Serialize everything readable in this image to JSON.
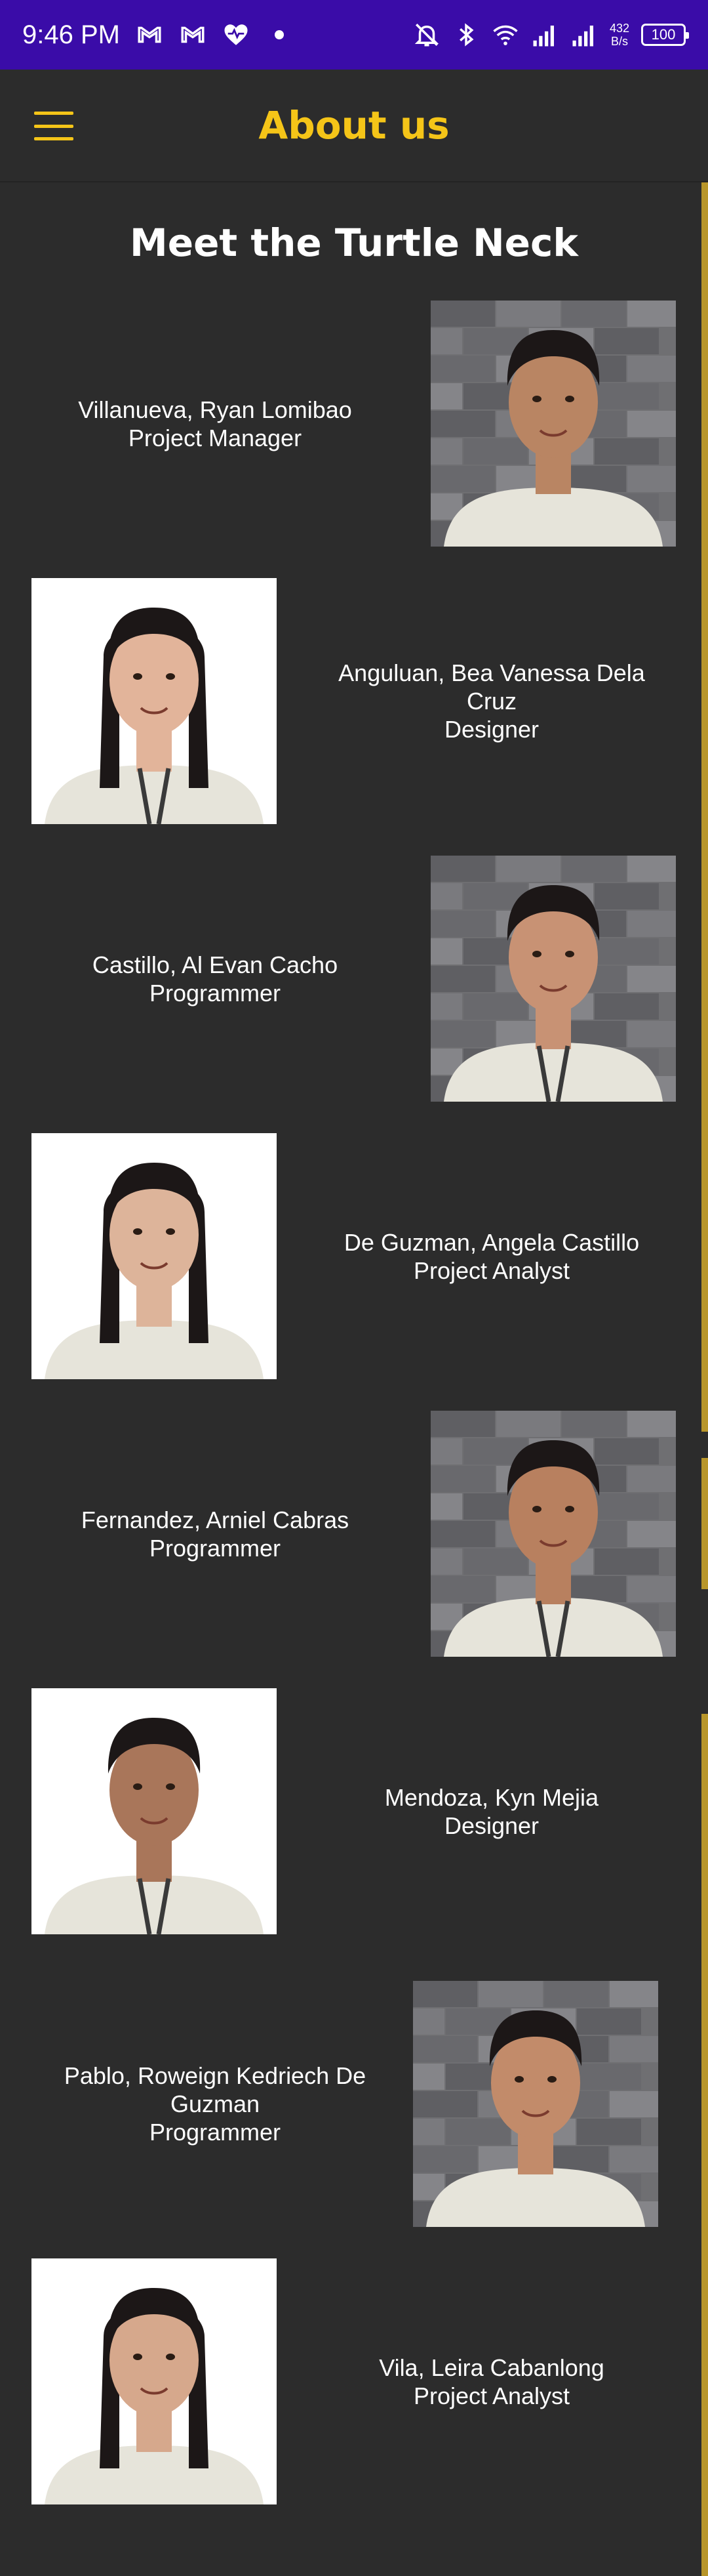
{
  "status_bar": {
    "time": "9:46 PM",
    "icons": [
      "gmail-icon",
      "gmail-icon",
      "health-heart-icon",
      "dot-icon",
      "bell-off-icon",
      "bluetooth-icon",
      "wifi-icon",
      "signal-icon",
      "signal-icon"
    ],
    "net_speed_value": "432",
    "net_speed_unit": "B/s",
    "battery": "100"
  },
  "app_bar": {
    "title": "About us",
    "menu_icon": "hamburger-menu-icon"
  },
  "colors": {
    "status_bar": "#3a0ca8",
    "background": "#2c2c2c",
    "accent": "#f5c518",
    "scrollbar": "#b8962a"
  },
  "page": {
    "heading": "Meet the Turtle Neck"
  },
  "members": [
    {
      "name": "Villanueva, Ryan Lomibao",
      "role": "Project Manager",
      "photo_side": "right",
      "photo_bg": "stone"
    },
    {
      "name": "Anguluan, Bea Vanessa Dela Cruz",
      "role": "Designer",
      "photo_side": "left",
      "photo_bg": "white"
    },
    {
      "name": "Castillo, Al Evan Cacho",
      "role": "Programmer",
      "photo_side": "right",
      "photo_bg": "stone"
    },
    {
      "name": "De Guzman, Angela Castillo",
      "role": "Project Analyst",
      "photo_side": "left",
      "photo_bg": "white"
    },
    {
      "name": "Fernandez, Arniel Cabras",
      "role": "Programmer",
      "photo_side": "right",
      "photo_bg": "stone"
    },
    {
      "name": "Mendoza, Kyn Mejia",
      "role": "Designer",
      "photo_side": "left",
      "photo_bg": "white"
    },
    {
      "name": "Pablo, Roweign Kedriech De Guzman",
      "role": "Programmer",
      "photo_side": "right",
      "photo_bg": "stone"
    },
    {
      "name": "Vila, Leira Cabanlong",
      "role": "Project Analyst",
      "photo_side": "left",
      "photo_bg": "white"
    }
  ]
}
